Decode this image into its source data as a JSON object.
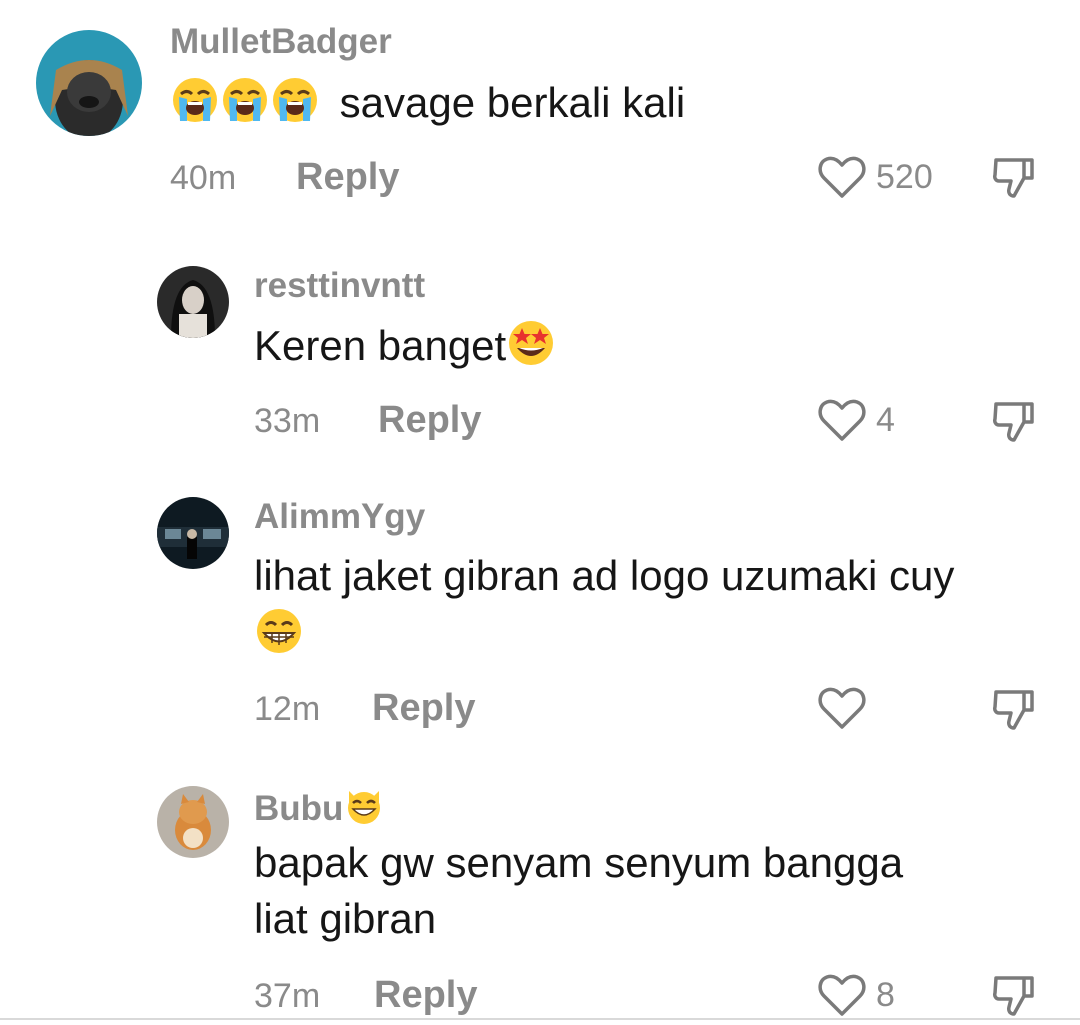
{
  "comments": [
    {
      "username": "MulletBadger",
      "text": "savage berkali kali",
      "leading_emojis": [
        "loudly-crying-face",
        "loudly-crying-face",
        "loudly-crying-face"
      ],
      "time": "40m",
      "reply_label": "Reply",
      "likes": "520"
    },
    {
      "username": "resttinvntt",
      "text": "Keren banget",
      "trailing_emoji": "star-struck",
      "time": "33m",
      "reply_label": "Reply",
      "likes": "4"
    },
    {
      "username": "AlimmYgy",
      "text_line1": "lihat jaket gibran ad logo uzumaki cuy",
      "trailing_emoji": "grinning-face",
      "time": "12m",
      "reply_label": "Reply",
      "likes": ""
    },
    {
      "username": "Bubu",
      "username_emoji": "grinning-cat",
      "text_line1": "bapak gw senyam senyum bangga",
      "text_line2": "liat gibran",
      "time": "37m",
      "reply_label": "Reply",
      "likes": "8"
    }
  ],
  "colors": {
    "muted_text": "#8a8a8a",
    "body_text": "#161616",
    "emoji_yellow": "#ffcc33"
  }
}
